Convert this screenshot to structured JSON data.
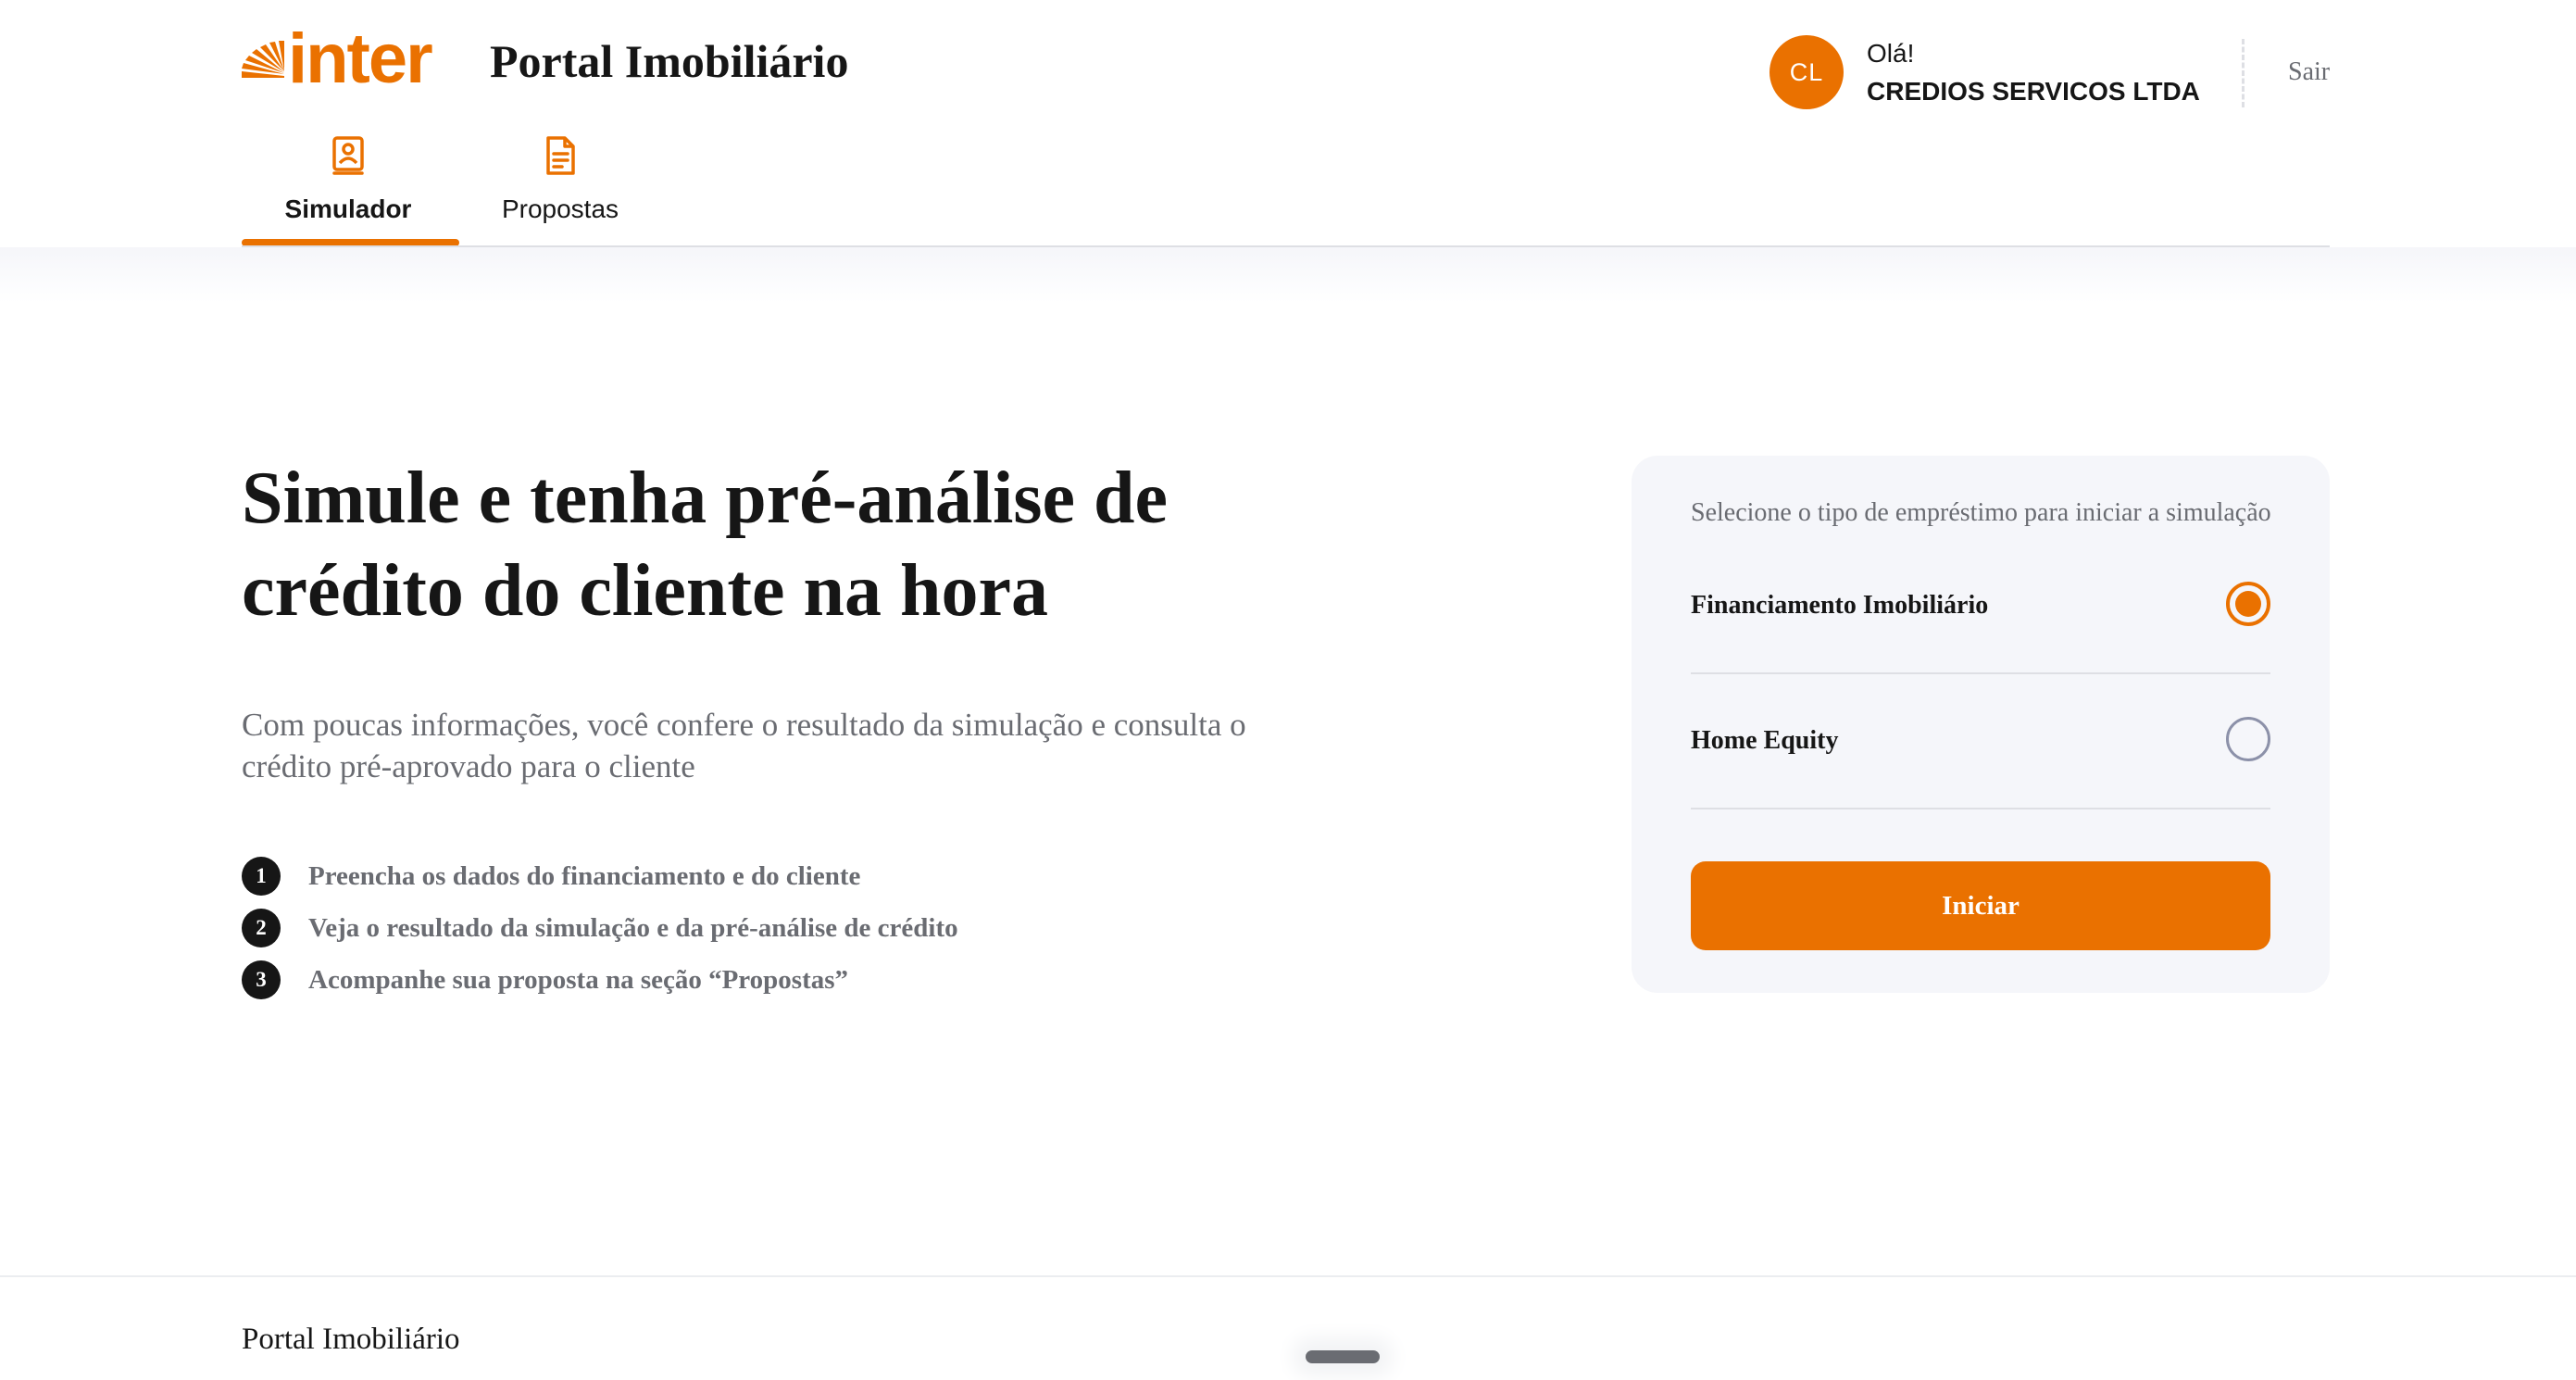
{
  "header": {
    "logo_text": "inter",
    "portal_title": "Portal Imobiliário",
    "avatar_initials": "CL",
    "greeting": "Olá!",
    "company": "CREDIOS SERVICOS LTDA",
    "logout": "Sair"
  },
  "tabs": [
    {
      "label": "Simulador",
      "icon": "person-card-icon",
      "active": true
    },
    {
      "label": "Propostas",
      "icon": "document-icon",
      "active": false
    }
  ],
  "hero": {
    "title_line1": "Simule e tenha pré-análise de",
    "title_line2": "crédito do cliente na hora",
    "subtitle_line1": "Com poucas informações, você confere o resultado da simulação e consulta o",
    "subtitle_line2": "crédito pré-aprovado para o cliente",
    "steps": [
      {
        "number": "1",
        "text": "Preencha os dados do financiamento e do cliente"
      },
      {
        "number": "2",
        "text": "Veja o resultado da simulação e da pré-análise de crédito"
      },
      {
        "number": "3",
        "text": "Acompanhe sua proposta na seção “Propostas”"
      }
    ]
  },
  "card": {
    "caption": "Selecione o tipo de empréstimo para iniciar a simulação",
    "options": [
      {
        "label": "Financiamento Imobiliário",
        "selected": true
      },
      {
        "label": "Home Equity",
        "selected": false
      }
    ],
    "button": "Iniciar"
  },
  "footer": {
    "title": "Portal Imobiliário"
  },
  "colors": {
    "brand": "#EA7100",
    "text": "#161616",
    "muted": "#6A6C72",
    "card_bg": "#F5F6FA",
    "divider": "#DEDFE4"
  }
}
